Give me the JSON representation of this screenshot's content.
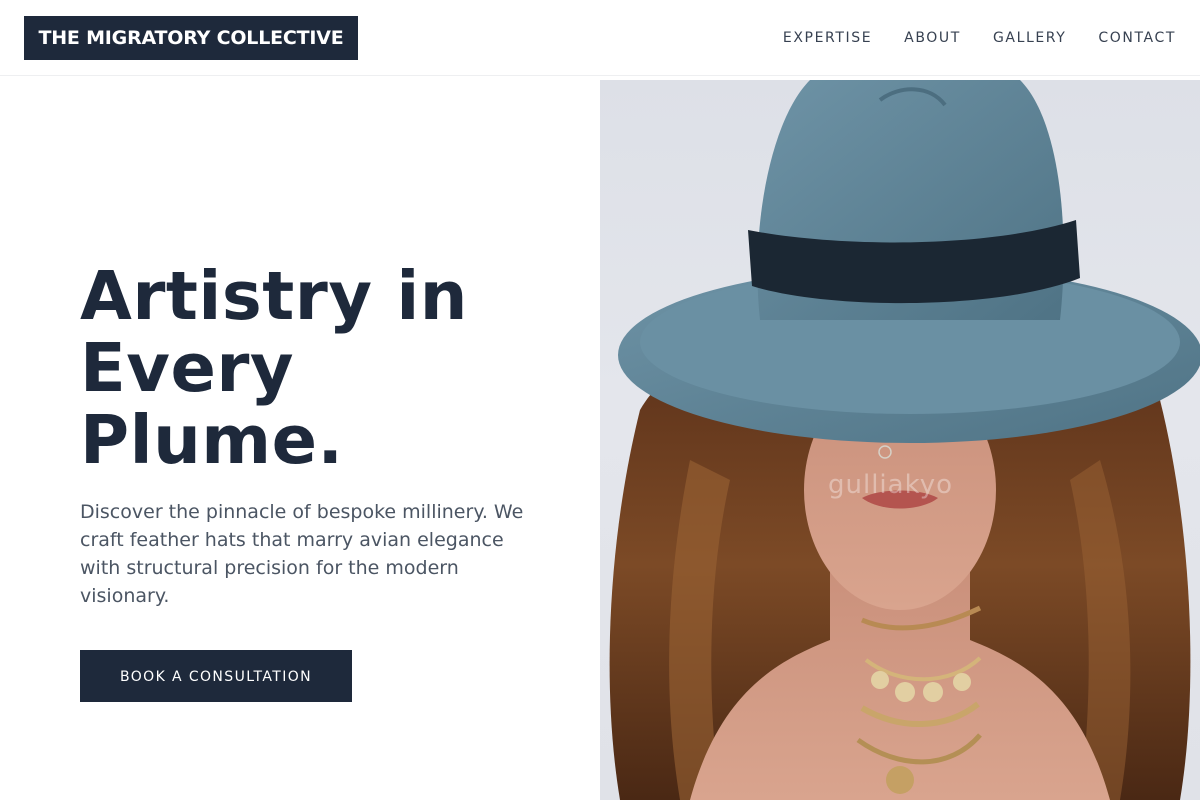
{
  "header": {
    "logo_text": "THE MIGRATORY COLLECTIVE",
    "nav": [
      {
        "label": "EXPERTISE"
      },
      {
        "label": "ABOUT"
      },
      {
        "label": "GALLERY"
      },
      {
        "label": "CONTACT"
      }
    ]
  },
  "hero": {
    "headline_lines": [
      "Artistry in",
      "Every",
      "Plume."
    ],
    "description": "Discover the pinnacle of bespoke millinery. We craft feather hats that marry avian elegance with structural precision for the modern visionary.",
    "cta_label": "BOOK A CONSULTATION",
    "image": {
      "watermark": "gulliakyo",
      "subject": "woman-in-blue-felt-hat"
    }
  },
  "colors": {
    "brand_navy": "#1e293b",
    "nav_text": "#374151",
    "body_text": "#4b5563",
    "hat_blue": "#5f8497",
    "hat_band": "#1b2733"
  }
}
